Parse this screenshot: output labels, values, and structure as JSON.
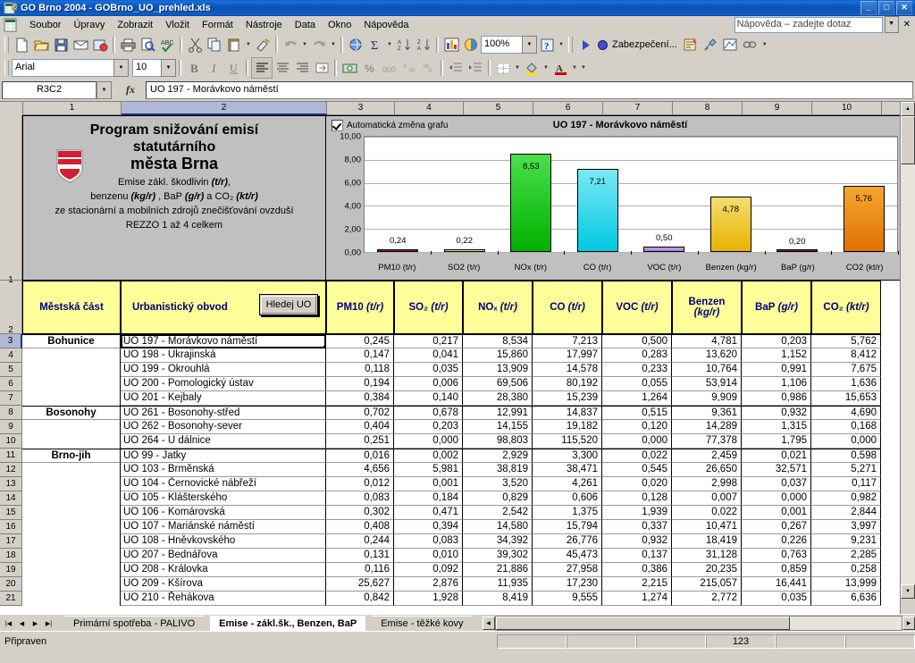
{
  "window": {
    "title": "GO Brno 2004 - GOBrno_UO_prehled.xls",
    "minimize": "_",
    "maximize": "□",
    "close": "✕"
  },
  "menu": {
    "items": [
      "Soubor",
      "Úpravy",
      "Zobrazit",
      "Vložit",
      "Formát",
      "Nástroje",
      "Data",
      "Okno",
      "Nápověda"
    ],
    "ask_placeholder": "Nápověda – zadejte dotaz",
    "doc_close": "✕"
  },
  "toolbar": {
    "zoom": "100%",
    "security_label": "Zabezpečení...",
    "font": "Arial",
    "font_size": "10"
  },
  "formula_bar": {
    "name_box": "R3C2",
    "fx": "fx",
    "content": "UO 197 - Morávkovo náměstí"
  },
  "grid": {
    "column_headers": [
      "1",
      "2",
      "3",
      "4",
      "5",
      "6",
      "7",
      "8",
      "9",
      "10"
    ],
    "selected_column": "2",
    "row_headers": [
      "1",
      "2",
      "3",
      "4",
      "5",
      "6",
      "7",
      "8",
      "9",
      "10",
      "11",
      "12",
      "13",
      "14",
      "15",
      "16",
      "17",
      "18",
      "19",
      "20",
      "21"
    ],
    "selected_row": "3"
  },
  "banner": {
    "title_line1": "Program snižování emisí",
    "title_line2": "statutárního",
    "title_line3": "města Brna",
    "sub_line1_a": "Emise zákl. škodlivin ",
    "sub_line1_b": "(t/r)",
    "sub_line1_c": ",",
    "sub_line2_a": "benzenu ",
    "sub_line2_b": "(kg/r)",
    "sub_line2_c": " , BaP ",
    "sub_line2_d": "(g/r)",
    "sub_line2_e": " a CO₂ ",
    "sub_line2_f": "(kt/r)",
    "sub_line3": "ze stacionární a mobilních zdrojů znečišťování ovzduší",
    "sub_line4": "REZZO 1 až 4 celkem"
  },
  "chart_panel": {
    "auto_update_label": "Automatická změna grafu",
    "auto_update_checked": true
  },
  "chart_data": {
    "type": "bar",
    "title": "UO 197 - Morávkovo náměstí",
    "categories": [
      "PM10 (t/r)",
      "SO2 (t/r)",
      "NOx (t/r)",
      "CO (t/r)",
      "VOC (t/r)",
      "Benzen (kg/r)",
      "BaP (g/r)",
      "CO2 (kt/r)"
    ],
    "values": [
      0.24,
      0.22,
      8.53,
      7.21,
      0.5,
      4.78,
      0.2,
      5.76
    ],
    "data_labels": [
      "0,24",
      "0,22",
      "8,53",
      "7,21",
      "0,50",
      "4,78",
      "0,20",
      "5,76"
    ],
    "ytick_labels": [
      "10,00",
      "8,00",
      "6,00",
      "4,00",
      "2,00",
      "0,00"
    ],
    "ytick_values": [
      10,
      8,
      6,
      4,
      2,
      0
    ],
    "ylim": [
      0,
      10
    ],
    "xlabel": "",
    "ylabel": "",
    "grid": true,
    "legend": "none",
    "bar_colors": [
      "#8b1a1a",
      "#d9dd8f",
      "#00b000",
      "#00c8e0",
      "#9b7ad1",
      "#e8b200",
      "#6b1f1f",
      "#e07000"
    ],
    "bar_colors_top": [
      "#b03030",
      "#eef0c8",
      "#4ae04a",
      "#7ae8f5",
      "#c0a8e8",
      "#f5dd70",
      "#8b3030",
      "#f5a830"
    ]
  },
  "table": {
    "headers": [
      {
        "label": "Městská část",
        "unit": ""
      },
      {
        "label": "Urbanistický obvod",
        "unit": ""
      },
      {
        "label": "PM10",
        "unit": "(t/r)"
      },
      {
        "label": "SO₂",
        "unit": "(t/r)"
      },
      {
        "label": "NOₓ",
        "unit": "(t/r)"
      },
      {
        "label": "CO",
        "unit": "(t/r)"
      },
      {
        "label": "VOC",
        "unit": "(t/r)"
      },
      {
        "label": "Benzen",
        "unit": "(kg/r)"
      },
      {
        "label": "BaP",
        "unit": "(g/r)"
      },
      {
        "label": "CO₂",
        "unit": "(kt/r)"
      }
    ],
    "search_button": "Hledej UO",
    "rows": [
      {
        "row": "3",
        "district": "Bohunice",
        "group_start": true,
        "uo": "UO 197 - Morávkovo náměstí",
        "selected": true,
        "values": [
          "0,245",
          "0,217",
          "8,534",
          "7,213",
          "0,500",
          "4,781",
          "0,203",
          "5,762"
        ]
      },
      {
        "row": "4",
        "district": "",
        "group_start": false,
        "uo": "UO 198 - Ukrajinská",
        "selected": false,
        "values": [
          "0,147",
          "0,041",
          "15,860",
          "17,997",
          "0,283",
          "13,620",
          "1,152",
          "8,412"
        ]
      },
      {
        "row": "5",
        "district": "",
        "group_start": false,
        "uo": "UO 199 - Okrouhlá",
        "selected": false,
        "values": [
          "0,118",
          "0,035",
          "13,909",
          "14,578",
          "0,233",
          "10,764",
          "0,991",
          "7,675"
        ]
      },
      {
        "row": "6",
        "district": "",
        "group_start": false,
        "uo": "UO 200 - Pomologický ústav",
        "selected": false,
        "values": [
          "0,194",
          "0,006",
          "69,506",
          "80,192",
          "0,055",
          "53,914",
          "1,106",
          "1,636"
        ]
      },
      {
        "row": "7",
        "district": "",
        "group_start": false,
        "uo": "UO 201 - Kejbaly",
        "selected": false,
        "values": [
          "0,384",
          "0,140",
          "28,380",
          "15,239",
          "1,264",
          "9,909",
          "0,986",
          "15,653"
        ]
      },
      {
        "row": "8",
        "district": "Bosonohy",
        "group_start": true,
        "uo": "UO 261 - Bosonohy-střed",
        "selected": false,
        "values": [
          "0,702",
          "0,678",
          "12,991",
          "14,837",
          "0,515",
          "9,361",
          "0,932",
          "4,690"
        ]
      },
      {
        "row": "9",
        "district": "",
        "group_start": false,
        "uo": "UO 262 - Bosonohy-sever",
        "selected": false,
        "values": [
          "0,404",
          "0,203",
          "14,155",
          "19,182",
          "0,120",
          "14,289",
          "1,315",
          "0,168"
        ]
      },
      {
        "row": "10",
        "district": "",
        "group_start": false,
        "uo": "UO 264 - U dálnice",
        "selected": false,
        "values": [
          "0,251",
          "0,000",
          "98,803",
          "115,520",
          "0,000",
          "77,378",
          "1,795",
          "0,000"
        ]
      },
      {
        "row": "11",
        "district": "Brno-jih",
        "group_start": true,
        "uo": "UO 99 - Jatky",
        "selected": false,
        "values": [
          "0,016",
          "0,002",
          "2,929",
          "3,300",
          "0,022",
          "2,459",
          "0,021",
          "0,598"
        ]
      },
      {
        "row": "12",
        "district": "",
        "group_start": false,
        "uo": "UO 103 - Brměnská",
        "selected": false,
        "values": [
          "4,656",
          "5,981",
          "38,819",
          "38,471",
          "0,545",
          "26,650",
          "32,571",
          "5,271"
        ]
      },
      {
        "row": "13",
        "district": "",
        "group_start": false,
        "uo": "UO 104 - Černovické nábřeží",
        "selected": false,
        "values": [
          "0,012",
          "0,001",
          "3,520",
          "4,261",
          "0,020",
          "2,998",
          "0,037",
          "0,117"
        ]
      },
      {
        "row": "14",
        "district": "",
        "group_start": false,
        "uo": "UO 105 - Klášterského",
        "selected": false,
        "values": [
          "0,083",
          "0,184",
          "0,829",
          "0,606",
          "0,128",
          "0,007",
          "0,000",
          "0,982"
        ]
      },
      {
        "row": "15",
        "district": "",
        "group_start": false,
        "uo": "UO 106 - Komárovská",
        "selected": false,
        "values": [
          "0,302",
          "0,471",
          "2,542",
          "1,375",
          "1,939",
          "0,022",
          "0,001",
          "2,844"
        ]
      },
      {
        "row": "16",
        "district": "",
        "group_start": false,
        "uo": "UO 107 - Mariánské náměstí",
        "selected": false,
        "values": [
          "0,408",
          "0,394",
          "14,580",
          "15,794",
          "0,337",
          "10,471",
          "0,267",
          "3,997"
        ]
      },
      {
        "row": "17",
        "district": "",
        "group_start": false,
        "uo": "UO 108 - Hněvkovského",
        "selected": false,
        "values": [
          "0,244",
          "0,083",
          "34,392",
          "26,776",
          "0,932",
          "18,419",
          "0,226",
          "9,231"
        ]
      },
      {
        "row": "18",
        "district": "",
        "group_start": false,
        "uo": "UO 207 - Bednářova",
        "selected": false,
        "values": [
          "0,131",
          "0,010",
          "39,302",
          "45,473",
          "0,137",
          "31,128",
          "0,763",
          "2,285"
        ]
      },
      {
        "row": "19",
        "district": "",
        "group_start": false,
        "uo": "UO 208 - Královka",
        "selected": false,
        "values": [
          "0,116",
          "0,092",
          "21,886",
          "27,958",
          "0,386",
          "20,235",
          "0,859",
          "0,258"
        ]
      },
      {
        "row": "20",
        "district": "",
        "group_start": false,
        "uo": "UO 209 - Kšírova",
        "selected": false,
        "values": [
          "25,627",
          "2,876",
          "11,935",
          "17,230",
          "2,215",
          "215,057",
          "16,441",
          "13,999"
        ]
      },
      {
        "row": "21",
        "district": "",
        "group_start": false,
        "uo": "UO 210 - Řehákova",
        "selected": false,
        "values": [
          "0,842",
          "1,928",
          "8,419",
          "9,555",
          "1,274",
          "2,772",
          "0,035",
          "6,636"
        ]
      }
    ]
  },
  "sheet_tabs": {
    "tabs": [
      {
        "label": "Primární spotřeba - PALIVO",
        "active": false
      },
      {
        "label": "Emise - zákl.šk., Benzen, BaP",
        "active": true
      },
      {
        "label": "Emise - těžké kovy",
        "active": false
      }
    ]
  },
  "status_bar": {
    "text": "Připraven",
    "num_lock": "123"
  }
}
